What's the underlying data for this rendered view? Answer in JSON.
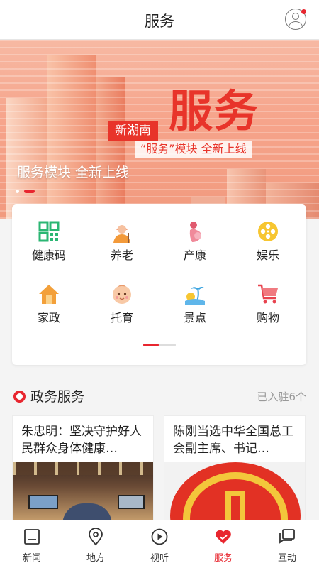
{
  "header": {
    "title": "服务"
  },
  "banner": {
    "headline": "服务",
    "tag_red": "新湖南",
    "tag_white": "“服务”模块 全新上线",
    "caption": "服务模块 全新上线"
  },
  "services": [
    {
      "label": "健康码",
      "icon": "qr-code-icon"
    },
    {
      "label": "养老",
      "icon": "elderly-icon"
    },
    {
      "label": "产康",
      "icon": "pregnancy-icon"
    },
    {
      "label": "娱乐",
      "icon": "film-reel-icon"
    },
    {
      "label": "家政",
      "icon": "house-icon"
    },
    {
      "label": "托育",
      "icon": "baby-icon"
    },
    {
      "label": "景点",
      "icon": "palm-beach-icon"
    },
    {
      "label": "购物",
      "icon": "shopping-cart-icon"
    }
  ],
  "section": {
    "title": "政务服务",
    "more": "已入驻6个"
  },
  "news": [
    {
      "title": "朱忠明：坚决守护好人民群众身体健康…"
    },
    {
      "title": "陈刚当选中华全国总工会副主席、书记…"
    }
  ],
  "bottom_nav": [
    {
      "label": "新闻",
      "icon": "newspaper-icon",
      "active": false
    },
    {
      "label": "地方",
      "icon": "location-pin-icon",
      "active": false
    },
    {
      "label": "视听",
      "icon": "play-icon",
      "active": false
    },
    {
      "label": "服务",
      "icon": "heart-icon",
      "active": true
    },
    {
      "label": "互动",
      "icon": "chat-icon",
      "active": false
    }
  ],
  "colors": {
    "accent": "#e8262f",
    "green": "#2bb673",
    "orange": "#f39a3a"
  }
}
